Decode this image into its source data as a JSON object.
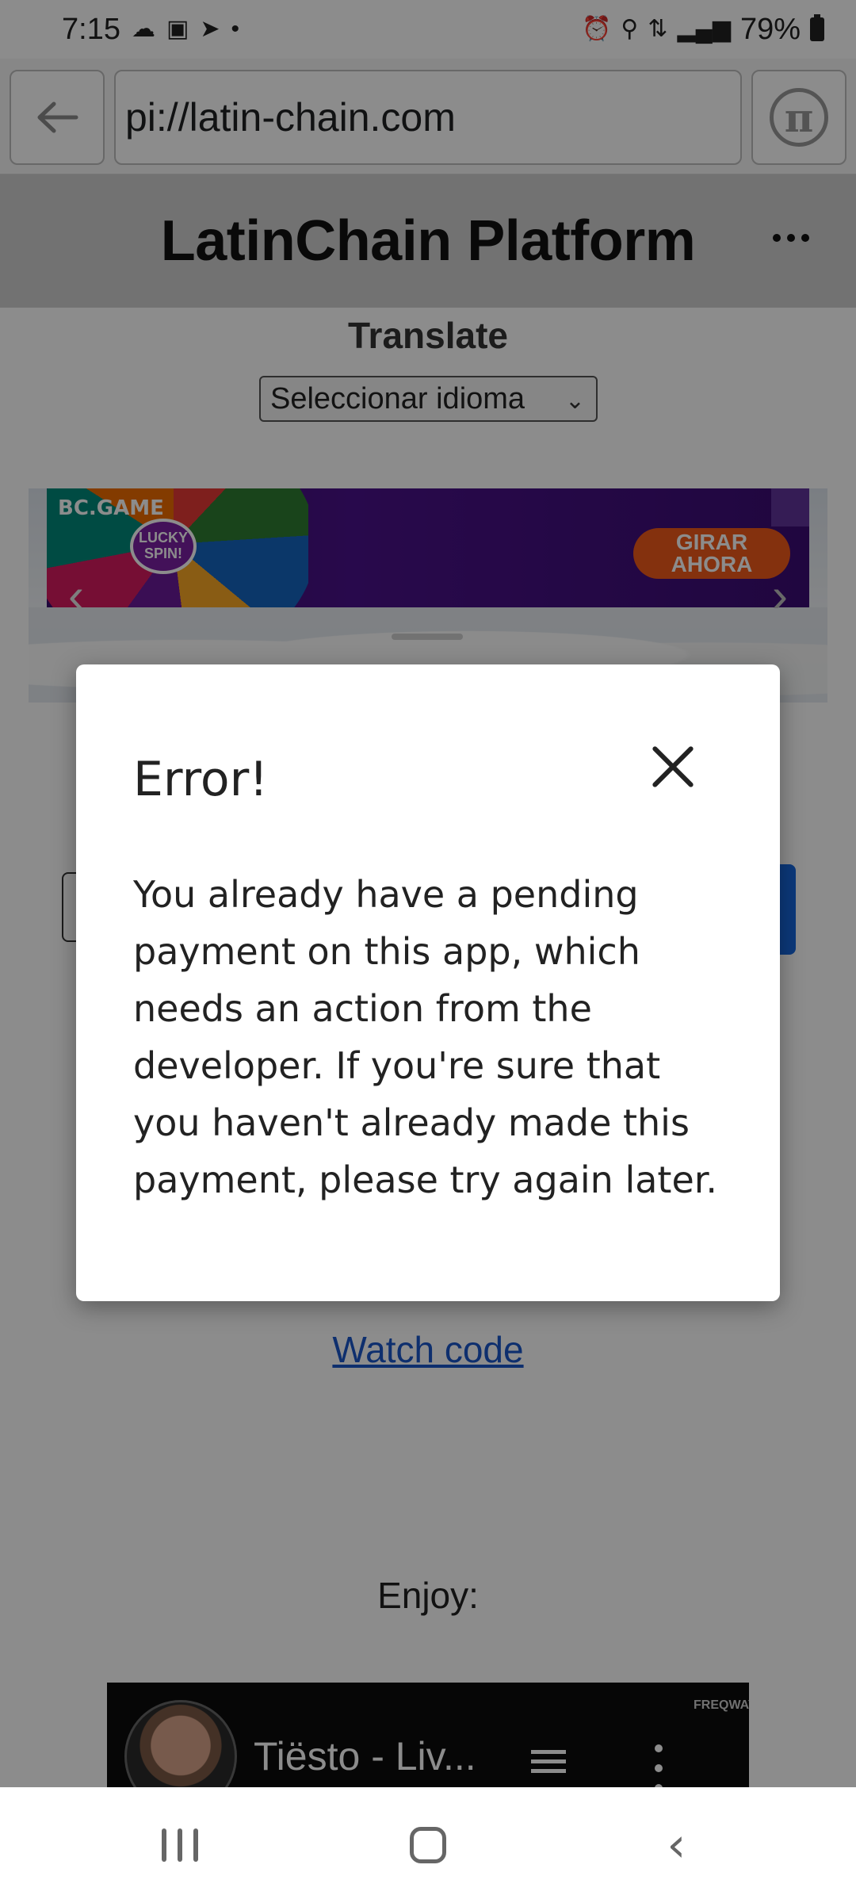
{
  "status_bar": {
    "time": "7:15",
    "left_icons": [
      "weather-icon",
      "image-icon",
      "telegram-icon",
      "dot-icon"
    ],
    "right_icons": [
      "alarm-icon",
      "location-icon",
      "data-icon",
      "signal-icon"
    ],
    "battery": "79%"
  },
  "browser": {
    "url": "pi://latin-chain.com"
  },
  "page": {
    "app_title": "LatinChain Platform",
    "translate_label": "Translate",
    "language_select": "Seleccionar idioma",
    "ad": {
      "brand": "BC.GAME",
      "wheel_label": "LUCKY SPIN!",
      "cta": "GIRAR AHORA"
    },
    "watch_code": "Watch code",
    "enjoy": "Enjoy:",
    "video": {
      "title": "Tiësto - Liv...",
      "brand": "FREQWAY"
    }
  },
  "dialog": {
    "title": "Error!",
    "body": "You already have a pending payment on this app, which needs an action from the developer. If you're sure that you haven't already made this payment, please try again later."
  },
  "nav": {
    "recent": "recent-apps-icon",
    "home": "home-icon",
    "back": "back-icon"
  }
}
